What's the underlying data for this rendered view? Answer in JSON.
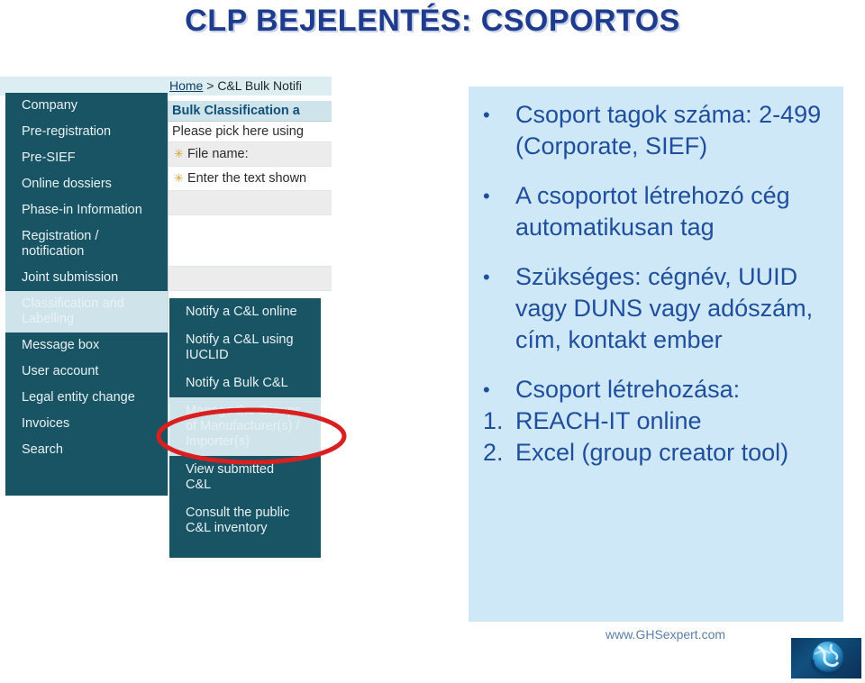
{
  "slide": {
    "title": "CLP BEJELENTÉS: CSOPORTOS",
    "title_color": "#1F3C8C"
  },
  "screenshot": {
    "breadcrumb": {
      "home_label": "Home",
      "rest": " > C&L Bulk Notifi"
    },
    "nav": {
      "background_color": "#195464",
      "items": [
        {
          "label": "Company",
          "active": false
        },
        {
          "label": "Pre-registration",
          "active": false
        },
        {
          "label": "Pre-SIEF",
          "active": false
        },
        {
          "label": "Online dossiers",
          "active": false
        },
        {
          "label": "Phase-in Information",
          "active": false
        },
        {
          "label": "Registration /\nnotification",
          "active": false
        },
        {
          "label": "Joint submission",
          "active": false
        },
        {
          "label": "Classification and\nLabelling",
          "active": true
        },
        {
          "label": "Message box",
          "active": false
        },
        {
          "label": "User account",
          "active": false
        },
        {
          "label": "Legal entity change",
          "active": false
        },
        {
          "label": "Invoices",
          "active": false
        },
        {
          "label": "Search",
          "active": false
        }
      ]
    },
    "form": {
      "heading": "Bulk Classification a",
      "note": "Please pick here using",
      "rows": [
        {
          "required": true,
          "label": "File name:"
        },
        {
          "required": true,
          "label": "Enter the text shown"
        }
      ]
    },
    "submenu": {
      "background_color": "#195464",
      "items": [
        {
          "label": "Notify a C&L online",
          "active": false
        },
        {
          "label": "Notify a C&L using\nIUCLID",
          "active": false
        },
        {
          "label": "Notify a Bulk C&L",
          "active": false
        },
        {
          "label": "Manage the Groups\nof Manufacturer(s) /\nImporter(s)",
          "active": true
        },
        {
          "label": "View submitted\nC&L",
          "active": false
        },
        {
          "label": "Consult the public\nC&L inventory",
          "active": false
        }
      ]
    },
    "annotation": {
      "shape": "red-ellipse",
      "color": "#D91F1F"
    }
  },
  "content": {
    "background_color": "#cfe8f7",
    "text_color": "#1F4E9C",
    "bullets": [
      {
        "marker": "•",
        "text": "Csoport tagok száma: 2-499 (Corporate, SIEF)"
      },
      {
        "marker": "•",
        "text": "A csoportot létrehozó cég automatikusan tag"
      },
      {
        "marker": "•",
        "text": "Szükséges: cégnév, UUID vagy  DUNS vagy adószám, cím, kontakt ember"
      },
      {
        "marker": "•",
        "text": "Csoport létrehozása:"
      },
      {
        "marker": "1.",
        "text": "REACH-IT online"
      },
      {
        "marker": "2.",
        "text": "Excel (group creator tool)"
      }
    ]
  },
  "footer": {
    "url": "www.GHSexpert.com",
    "logo_name": "globe-logo"
  }
}
